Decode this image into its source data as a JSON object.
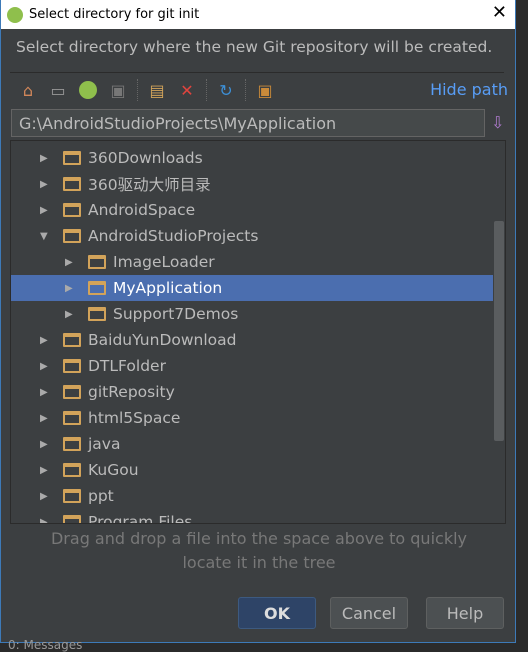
{
  "window": {
    "title": "Select directory for git init",
    "icon": "android-studio-icon"
  },
  "message": "Select directory where the new Git repository will be created.",
  "toolbar": {
    "icons": [
      "home-icon",
      "desktop-icon",
      "project-icon",
      "module-icon",
      "new-folder-icon",
      "delete-icon",
      "refresh-icon",
      "show-hidden-icon"
    ],
    "hide_path": "Hide path"
  },
  "path": "G:\\AndroidStudioProjects\\MyApplication",
  "tree": [
    {
      "label": "360Downloads",
      "depth": 0,
      "expanded": false
    },
    {
      "label": "360驱动大师目录",
      "depth": 0,
      "expanded": false
    },
    {
      "label": "AndroidSpace",
      "depth": 0,
      "expanded": false
    },
    {
      "label": "AndroidStudioProjects",
      "depth": 0,
      "expanded": true
    },
    {
      "label": "ImageLoader",
      "depth": 1,
      "expanded": false
    },
    {
      "label": "MyApplication",
      "depth": 1,
      "expanded": false,
      "selected": true
    },
    {
      "label": "Support7Demos",
      "depth": 1,
      "expanded": false
    },
    {
      "label": "BaiduYunDownload",
      "depth": 0,
      "expanded": false
    },
    {
      "label": "DTLFolder",
      "depth": 0,
      "expanded": false
    },
    {
      "label": "gitReposity",
      "depth": 0,
      "expanded": false
    },
    {
      "label": "html5Space",
      "depth": 0,
      "expanded": false
    },
    {
      "label": "java",
      "depth": 0,
      "expanded": false
    },
    {
      "label": "KuGou",
      "depth": 0,
      "expanded": false
    },
    {
      "label": "ppt",
      "depth": 0,
      "expanded": false
    },
    {
      "label": "Program Files",
      "depth": 0,
      "expanded": false
    }
  ],
  "hint": "Drag and drop a file into the space above to quickly locate it in the tree",
  "buttons": {
    "ok": "OK",
    "cancel": "Cancel",
    "help": "Help"
  },
  "background_text": "0: Messages",
  "colors": {
    "accent": "#589df6",
    "selection": "#4b6eaf",
    "folder": "#d2a35a"
  }
}
